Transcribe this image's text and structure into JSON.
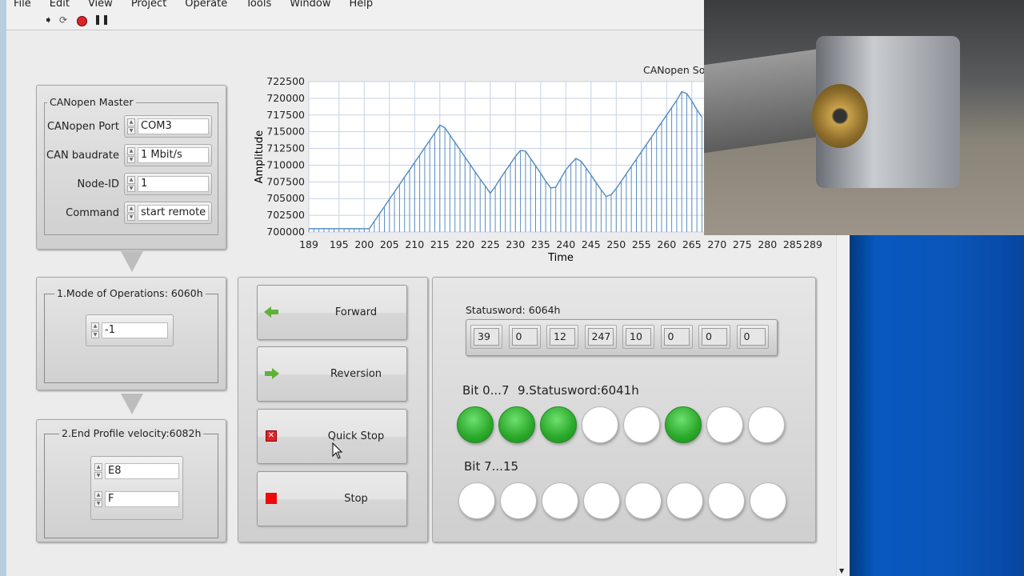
{
  "menu": [
    "File",
    "Edit",
    "View",
    "Project",
    "Operate",
    "Tools",
    "Window",
    "Help"
  ],
  "toolbar": {
    "icons": [
      "run-arrow-icon",
      "run-continuous-icon",
      "abort-icon",
      "pause-icon"
    ]
  },
  "master": {
    "title": "CANopen Master",
    "fields": [
      {
        "label": "CANopen Port",
        "value": "COM3"
      },
      {
        "label": "CAN baudrate",
        "value": "1 Mbit/s"
      },
      {
        "label": "Node-ID",
        "value": "1"
      },
      {
        "label": "Command",
        "value": "start remote"
      }
    ]
  },
  "mode": {
    "title": "1.Mode of Operations: 6060h",
    "value": "-1"
  },
  "velocity": {
    "title": "2.End Profile velocity:6082h",
    "values": [
      "E8",
      "F"
    ]
  },
  "buttons": [
    {
      "label": "Forward",
      "icon": "arrow-left-icon"
    },
    {
      "label": "Reversion",
      "icon": "arrow-right-icon"
    },
    {
      "label": "Quick Stop",
      "icon": "red-x-icon"
    },
    {
      "label": "Stop",
      "icon": "red-square-icon"
    }
  ],
  "status": {
    "title": "Statusword: 6064h",
    "values": [
      "39",
      "0",
      "12",
      "247",
      "10",
      "0",
      "0",
      "0"
    ],
    "bits_low_label": "Bit 0...7",
    "statusword_label": "9.Statusword:6041h",
    "bits_low": [
      1,
      1,
      1,
      0,
      0,
      1,
      0,
      0
    ],
    "bits_high_label": "Bit 7...15",
    "bits_high": [
      0,
      0,
      0,
      0,
      0,
      0,
      0,
      0
    ],
    "led_on_color": "#2aa82a"
  },
  "chart_title_partial": "CANopen So",
  "chart_data": {
    "type": "line",
    "style": "line with vertical drop lines",
    "xlabel": "Time",
    "ylabel": "Amplitude",
    "xlim": [
      189,
      289
    ],
    "ylim": [
      700000,
      722500
    ],
    "xticks": [
      189,
      195,
      200,
      205,
      210,
      215,
      220,
      225,
      230,
      235,
      240,
      245,
      250,
      255,
      260,
      265,
      270,
      275,
      280,
      285,
      289
    ],
    "yticks": [
      700000,
      702500,
      705000,
      707500,
      710000,
      712500,
      715000,
      717500,
      720000,
      722500
    ],
    "grid": true,
    "color": "#5b8fc0",
    "x": [
      189,
      190,
      191,
      192,
      193,
      194,
      195,
      196,
      197,
      198,
      199,
      200,
      201,
      202,
      203,
      204,
      205,
      206,
      207,
      208,
      209,
      210,
      211,
      212,
      213,
      214,
      215,
      216,
      217,
      218,
      219,
      220,
      221,
      222,
      223,
      224,
      225,
      226,
      227,
      228,
      229,
      230,
      231,
      232,
      233,
      234,
      235,
      236,
      237,
      238,
      239,
      240,
      241,
      242,
      243,
      244,
      245,
      246,
      247,
      248,
      249,
      250,
      251,
      252,
      253,
      254,
      255,
      256,
      257,
      258,
      259,
      260,
      261,
      262,
      263,
      264,
      265,
      266,
      267
    ],
    "y": [
      700500,
      700500,
      700500,
      700500,
      700500,
      700500,
      700500,
      700500,
      700500,
      700500,
      700500,
      700500,
      700500,
      701600,
      702700,
      703800,
      704900,
      706000,
      707100,
      708200,
      709300,
      710400,
      711500,
      712600,
      713700,
      714800,
      716000,
      715600,
      714500,
      713400,
      712300,
      711200,
      710100,
      709000,
      707900,
      706900,
      705800,
      706800,
      708000,
      709100,
      710200,
      711300,
      712200,
      712100,
      711000,
      709900,
      708800,
      707600,
      706600,
      706700,
      708000,
      709300,
      710200,
      711000,
      710600,
      709600,
      708500,
      707400,
      706300,
      705300,
      705600,
      706500,
      707600,
      708700,
      709800,
      710900,
      712000,
      713100,
      714200,
      715300,
      716400,
      717500,
      718600,
      719700,
      721000,
      720700,
      719600,
      718300,
      717200
    ]
  }
}
